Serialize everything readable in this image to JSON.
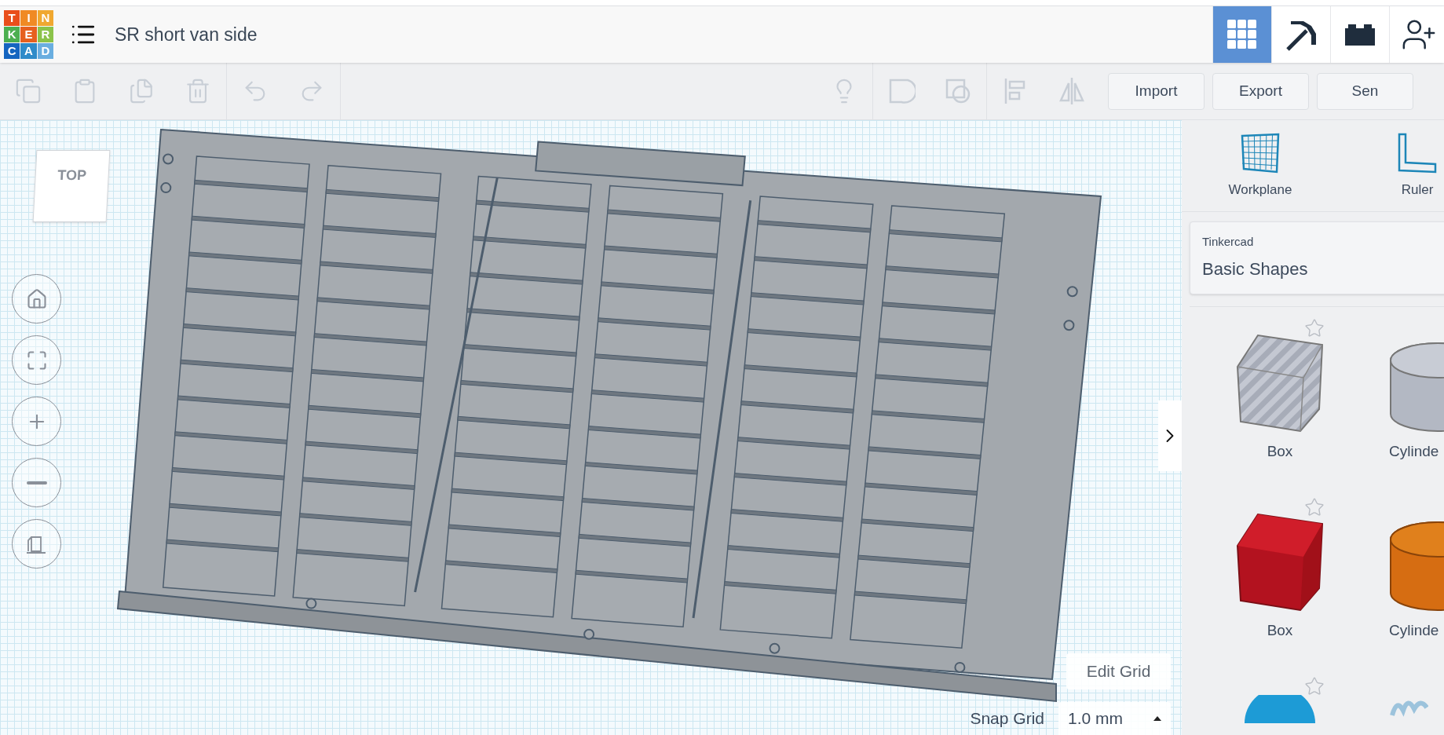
{
  "logo": {
    "letters": [
      {
        "char": "T",
        "color": "#e94e1b"
      },
      {
        "char": "I",
        "color": "#f08a24"
      },
      {
        "char": "N",
        "color": "#f0a830"
      },
      {
        "char": "K",
        "color": "#4caf50"
      },
      {
        "char": "E",
        "color": "#e6601f"
      },
      {
        "char": "R",
        "color": "#8bc34a"
      },
      {
        "char": "C",
        "color": "#1565c0"
      },
      {
        "char": "A",
        "color": "#2e8bc9"
      },
      {
        "char": "D",
        "color": "#6aaee0"
      }
    ]
  },
  "design_title": "SR short van side",
  "view_tabs": [
    {
      "selected": true
    },
    {
      "selected": false
    },
    {
      "selected": false
    }
  ],
  "toolbar": {
    "tools": [
      {
        "disabled": true
      },
      {
        "disabled": true
      },
      {
        "disabled": true
      },
      {
        "disabled": true
      },
      {
        "disabled": true
      },
      {
        "disabled": true
      },
      {
        "disabled": true
      },
      {
        "disabled": true
      },
      {
        "disabled": true
      },
      {
        "disabled": true
      },
      {
        "disabled": true
      }
    ],
    "buttons": [
      "Import",
      "Export",
      "Sen"
    ]
  },
  "viewport": {
    "view_cube": "TOP",
    "edit_grid": "Edit Grid",
    "snap_grid": {
      "label": "Snap Grid",
      "value": "1.0 mm"
    }
  },
  "panel": {
    "tools": [
      {
        "kind": "workplane",
        "label": "Workplane"
      },
      {
        "kind": "ruler",
        "label": "Ruler"
      }
    ],
    "library": {
      "source": "Tinkercad",
      "category": "Basic Shapes"
    },
    "shapes": [
      {
        "kind": "box-hole",
        "label": "Box",
        "favorite": false
      },
      {
        "kind": "cylinder-hole",
        "label": "Cylinde"
      },
      {
        "kind": "box",
        "label": "Box",
        "favorite": false
      },
      {
        "kind": "cylinder",
        "label": "Cylinde"
      },
      {
        "kind": "sphere",
        "favorite": false
      },
      {
        "kind": "scribble"
      }
    ]
  }
}
